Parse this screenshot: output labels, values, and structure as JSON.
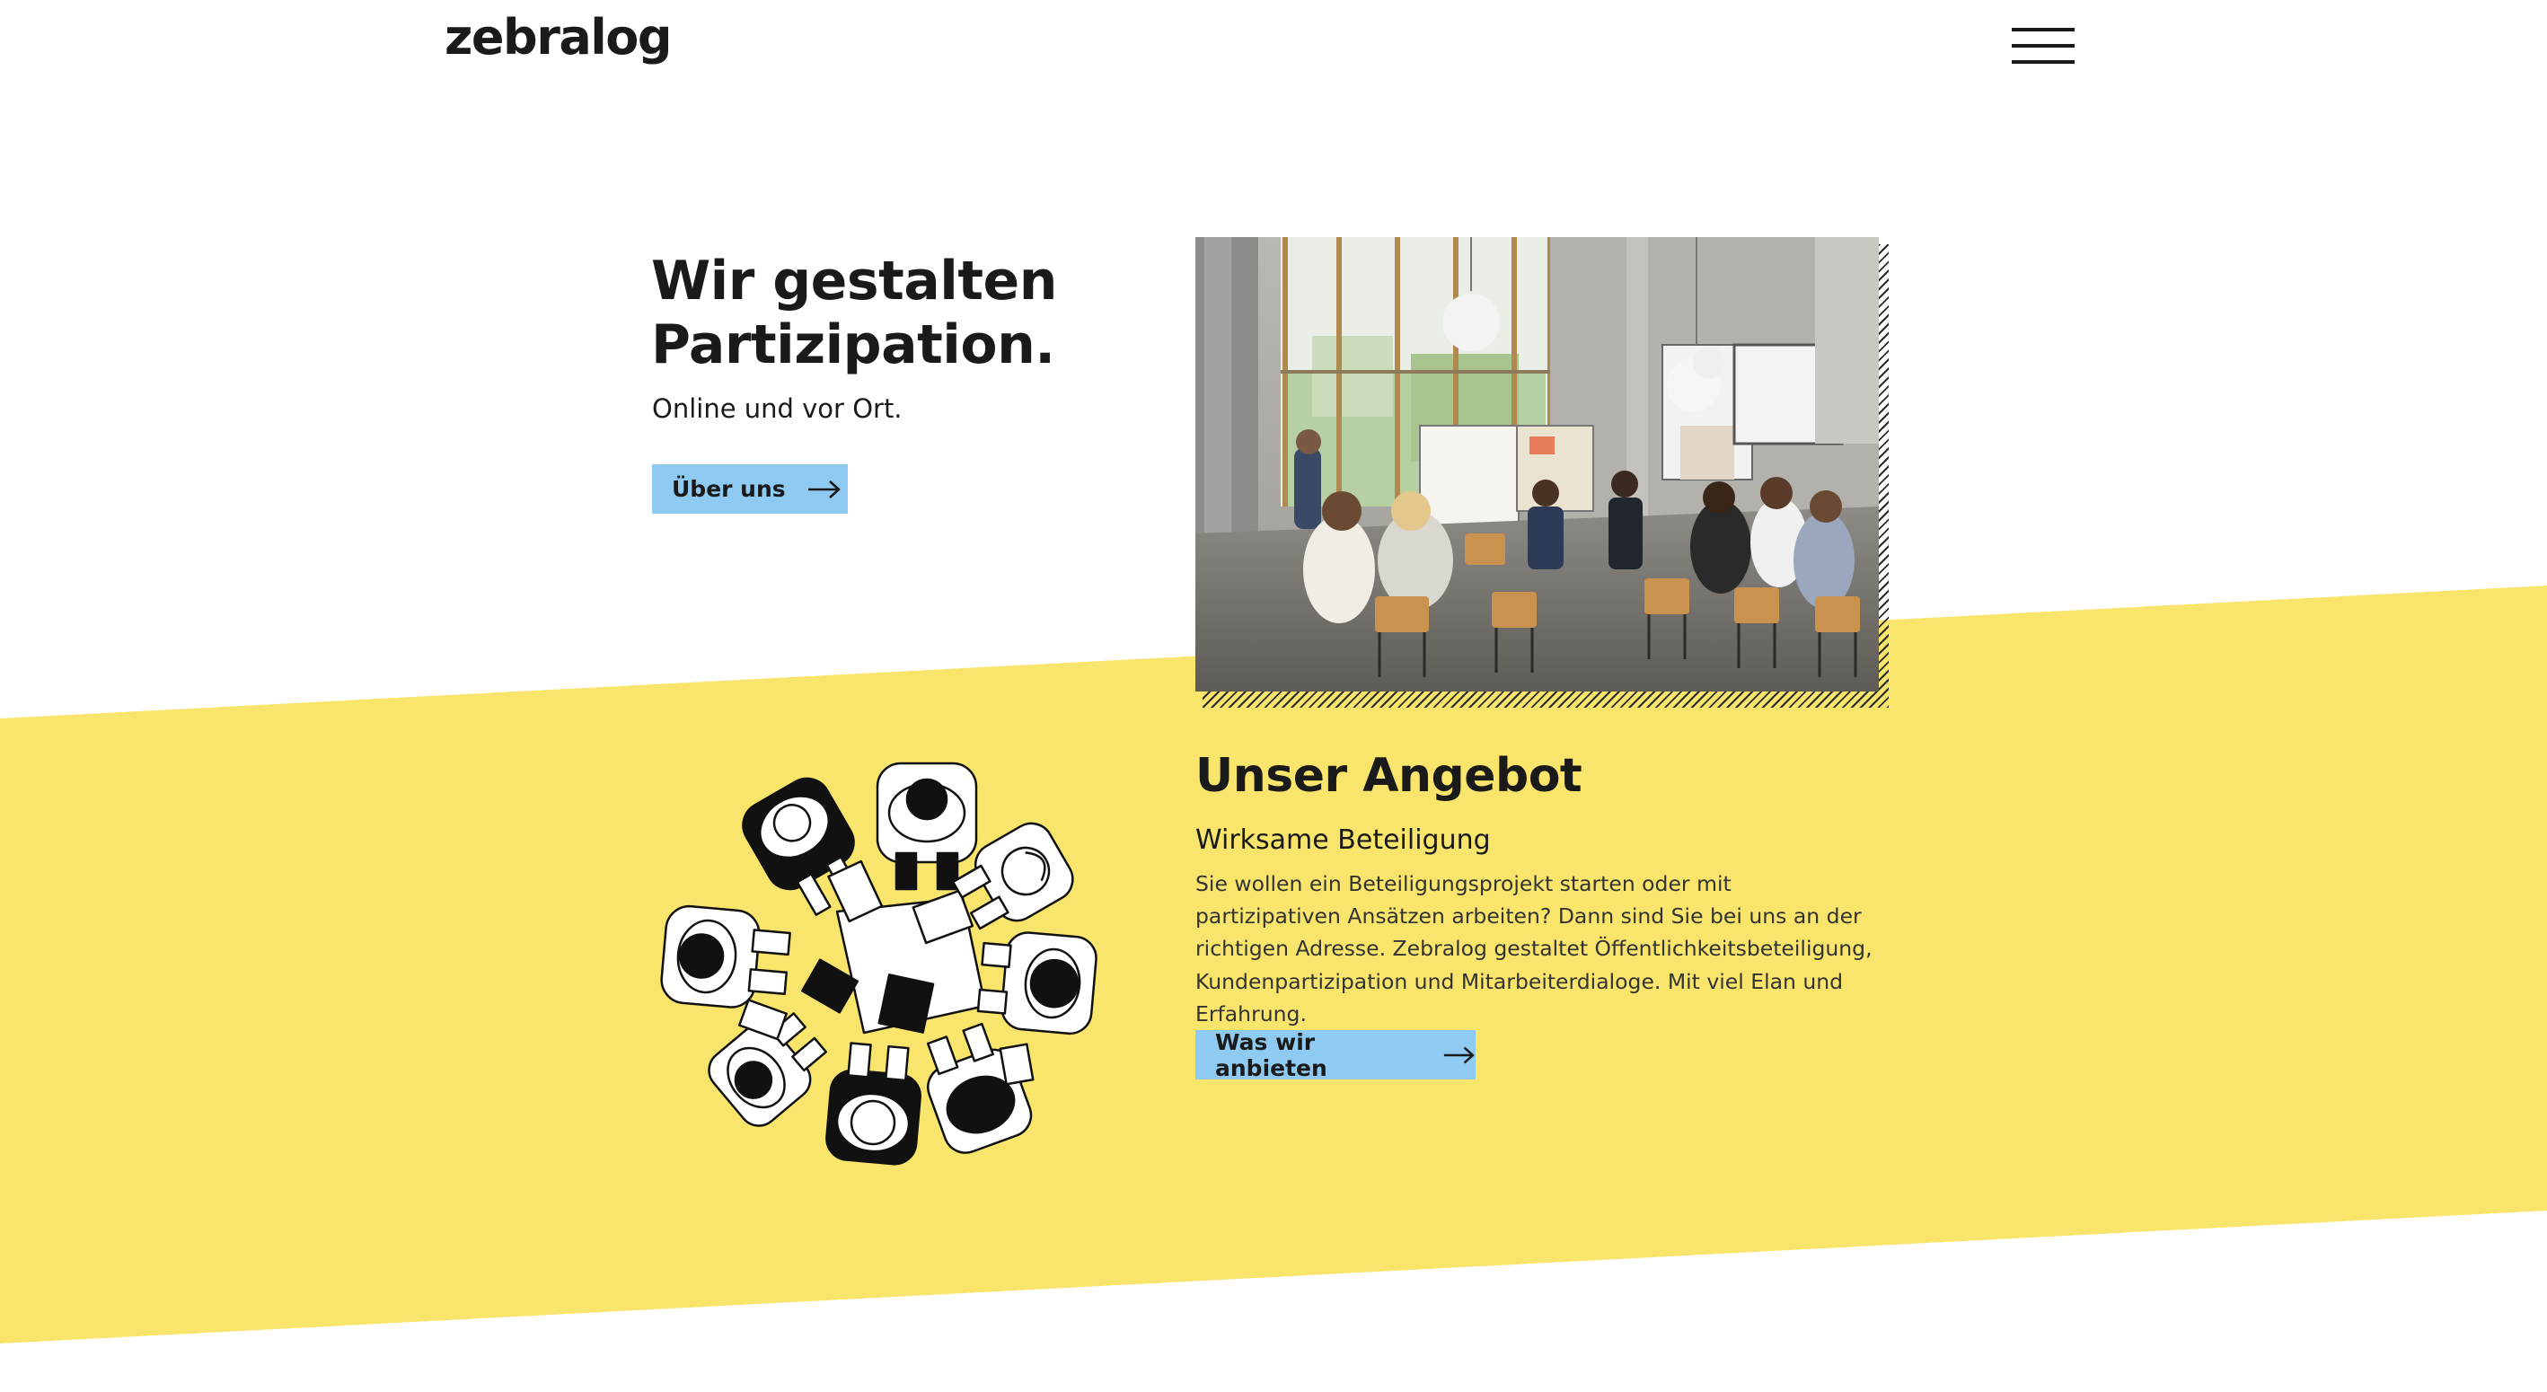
{
  "header": {
    "logo": "zebralog",
    "menu_icon": "hamburger-menu-icon"
  },
  "hero": {
    "title": "Wir gestalten Partizipation.",
    "subtitle": "Online und vor Ort.",
    "button_label": "Über uns",
    "button_icon": "arrow-right-icon",
    "photo": "workshop-photo"
  },
  "offer": {
    "title": "Unser Angebot",
    "subtitle": "Wirksame Beteiligung",
    "body": "Sie wollen ein Beteiligungsprojekt starten oder mit partizipativen Ansätzen arbeiten? Dann sind Sie bei uns an der richtigen Adresse. Zebralog gestaltet Öffentlichkeitsbeteiligung, Kundenpartizipation und Mitarbeiterdialoge. Mit viel Elan und Erfahrung.",
    "button_label": "Was wir anbieten",
    "button_icon": "arrow-right-icon",
    "illustration": "meeting-table-illustration"
  },
  "colors": {
    "accent_yellow": "#f9e56c",
    "button_blue": "#8ecaf2",
    "text_dark": "#1a1a1a"
  }
}
